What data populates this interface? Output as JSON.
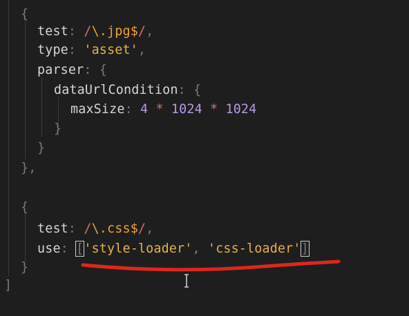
{
  "editor": {
    "lines": [
      {
        "tokens": [
          {
            "t": "{",
            "c": "punct"
          }
        ]
      },
      {
        "tokens": [
          {
            "t": "test",
            "c": "ident"
          },
          {
            "t": ": ",
            "c": "punct"
          },
          {
            "t": "/",
            "c": "regexdelim"
          },
          {
            "t": "\\.jpg$",
            "c": "regex"
          },
          {
            "t": "/",
            "c": "regexdelim"
          },
          {
            "t": ",",
            "c": "punct"
          }
        ]
      },
      {
        "tokens": [
          {
            "t": "type",
            "c": "ident"
          },
          {
            "t": ": ",
            "c": "punct"
          },
          {
            "t": "'asset'",
            "c": "str"
          },
          {
            "t": ",",
            "c": "punct"
          }
        ]
      },
      {
        "tokens": [
          {
            "t": "parser",
            "c": "ident"
          },
          {
            "t": ": ",
            "c": "punct"
          },
          {
            "t": "{",
            "c": "punct"
          }
        ]
      },
      {
        "tokens": [
          {
            "t": "dataUrlCondition",
            "c": "ident"
          },
          {
            "t": ": ",
            "c": "punct"
          },
          {
            "t": "{",
            "c": "punct"
          }
        ]
      },
      {
        "tokens": [
          {
            "t": "maxSize",
            "c": "ident"
          },
          {
            "t": ": ",
            "c": "punct"
          },
          {
            "t": "4",
            "c": "num"
          },
          {
            "t": " * ",
            "c": "op"
          },
          {
            "t": "1024",
            "c": "num"
          },
          {
            "t": " * ",
            "c": "op"
          },
          {
            "t": "1024",
            "c": "num"
          }
        ]
      },
      {
        "tokens": [
          {
            "t": "}",
            "c": "punct"
          }
        ]
      },
      {
        "tokens": [
          {
            "t": "}",
            "c": "punct"
          }
        ]
      },
      {
        "tokens": [
          {
            "t": "},",
            "c": "punct"
          }
        ]
      },
      {
        "tokens": []
      },
      {
        "tokens": [
          {
            "t": "{",
            "c": "punct"
          }
        ]
      },
      {
        "tokens": [
          {
            "t": "test",
            "c": "ident"
          },
          {
            "t": ": ",
            "c": "punct"
          },
          {
            "t": "/",
            "c": "regexdelim"
          },
          {
            "t": "\\.css$",
            "c": "regex"
          },
          {
            "t": "/",
            "c": "regexdelim"
          },
          {
            "t": ",",
            "c": "punct"
          }
        ]
      },
      {
        "tokens": [
          {
            "t": "use",
            "c": "ident"
          },
          {
            "t": ": ",
            "c": "punct"
          },
          {
            "t": "[",
            "c": "punct",
            "box": true
          },
          {
            "t": "'style-loader'",
            "c": "str"
          },
          {
            "t": ", ",
            "c": "punct"
          },
          {
            "t": "'css-loader'",
            "c": "str"
          },
          {
            "t": "]",
            "c": "punct",
            "box": true
          }
        ]
      },
      {
        "tokens": [
          {
            "t": "}",
            "c": "punct"
          }
        ]
      },
      {
        "tokens": [
          {
            "t": "]",
            "c": "punct"
          }
        ]
      }
    ]
  },
  "colors": {
    "background": "#1e1e1e",
    "annotation_stroke": "#e0261c"
  },
  "icons": {
    "mouse_cursor": "i-beam-cursor-icon"
  }
}
